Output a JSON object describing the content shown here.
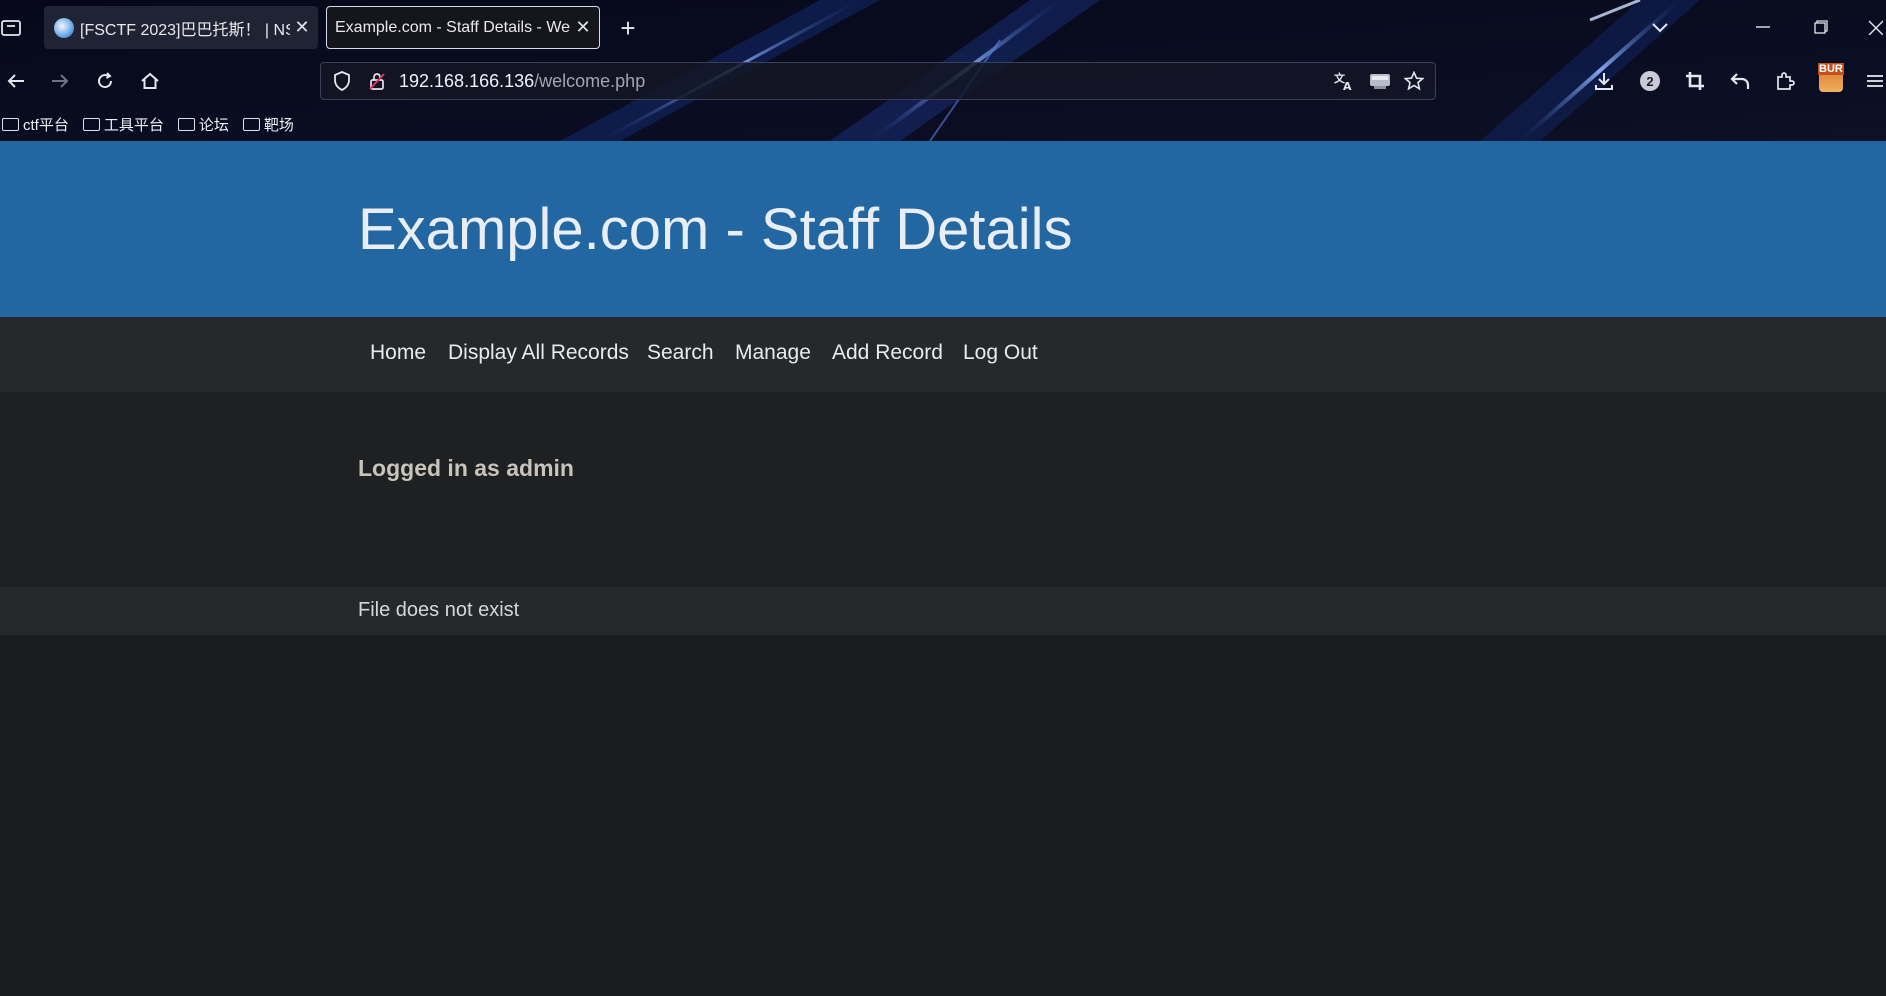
{
  "browser": {
    "tabs": [
      {
        "label": "[FSCTF 2023]巴巴托斯！ | NS"
      },
      {
        "label": "Example.com - Staff Details - We"
      }
    ],
    "url": {
      "host": "192.168.166.136",
      "path": "/welcome.php"
    },
    "extension_badge": "2",
    "profile_badge": "BUR",
    "bookmarks": [
      {
        "label": "ctf平台"
      },
      {
        "label": "工具平台"
      },
      {
        "label": "论坛"
      },
      {
        "label": "靶场"
      }
    ],
    "icons": [
      "tab-overview-icon",
      "close-tab-icon",
      "new-tab-icon",
      "tab-list-icon",
      "minimize-icon",
      "restore-icon",
      "close-window-icon",
      "back-icon",
      "forward-icon",
      "reload-icon",
      "home-icon",
      "shield-icon",
      "lock-icon",
      "translate-icon",
      "drive-icon",
      "star-icon",
      "download-icon",
      "crop-icon",
      "undo-icon",
      "extensions-icon",
      "menu-icon",
      "folder-icon"
    ]
  },
  "site": {
    "title": "Example.com - Staff Details",
    "nav": [
      {
        "label": "Home"
      },
      {
        "label": "Display All Records"
      },
      {
        "label": "Search"
      },
      {
        "label": "Manage"
      },
      {
        "label": "Add Record"
      },
      {
        "label": "Log Out"
      }
    ],
    "logged_in": "Logged in as admin",
    "footer": "File does not exist"
  },
  "colors": {
    "header_blue": "#2266a2",
    "menu_bg": "#26292b",
    "page_bg": "#1b1c1e",
    "chrome_bg": "#0b0d1c"
  }
}
